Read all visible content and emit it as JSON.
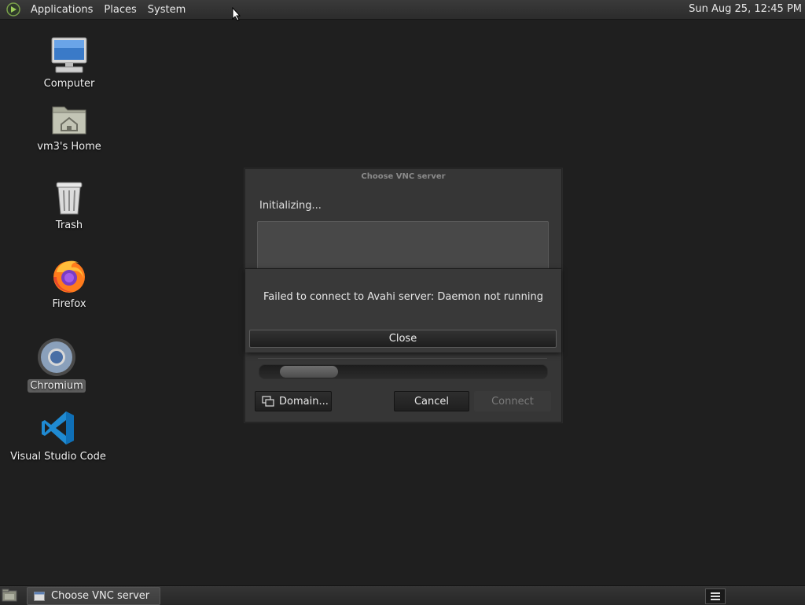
{
  "top_panel": {
    "menus": [
      "Applications",
      "Places",
      "System"
    ],
    "clock": "Sun Aug 25, 12:45 PM"
  },
  "desktop": {
    "icons": [
      {
        "label": "Computer",
        "icon": "computer-icon"
      },
      {
        "label": "vm3's Home",
        "icon": "home-folder-icon"
      },
      {
        "label": "Trash",
        "icon": "trash-icon"
      },
      {
        "label": "Firefox",
        "icon": "firefox-icon"
      },
      {
        "label": "Chromium",
        "icon": "chromium-icon",
        "selected": true
      },
      {
        "label": "Visual Studio Code",
        "icon": "vscode-icon"
      }
    ]
  },
  "vnc_dialog": {
    "title": "Choose VNC server",
    "status": "Initializing...",
    "domain_button": "Domain...",
    "cancel_button": "Cancel",
    "connect_button": "Connect"
  },
  "error_dialog": {
    "message": "Failed to connect to Avahi server: Daemon not running",
    "close_button": "Close"
  },
  "bottom_panel": {
    "task_title": "Choose VNC server"
  }
}
